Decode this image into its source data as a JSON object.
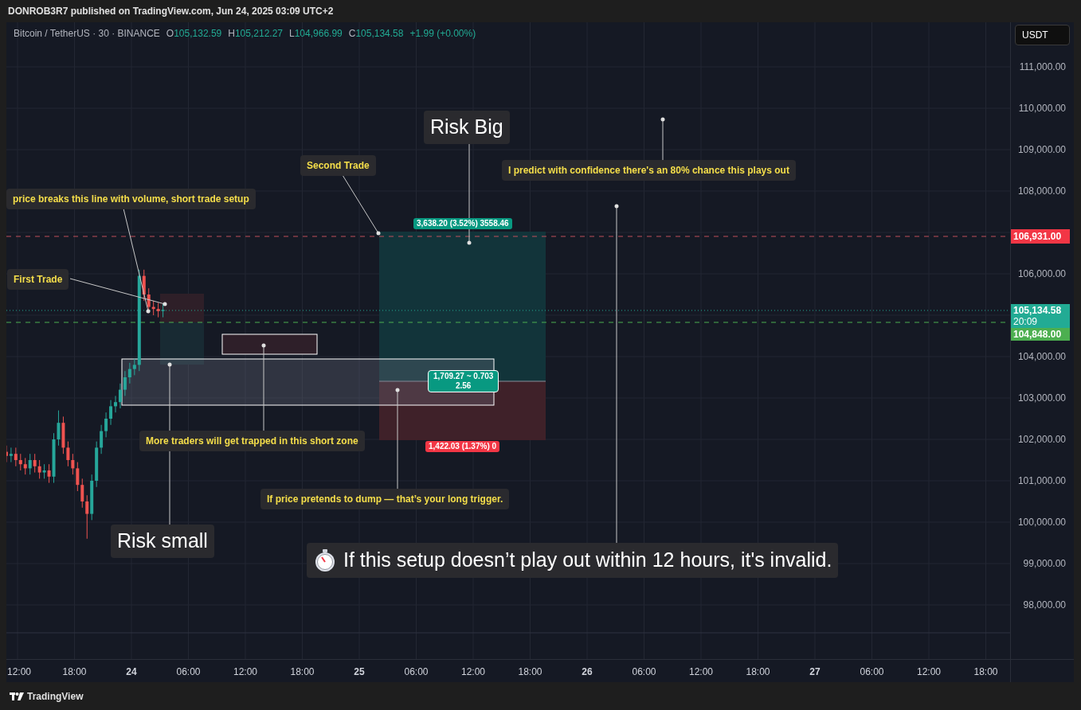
{
  "header": {
    "text": "DONROB3R7 published on TradingView.com, Jun 24, 2025 03:09 UTC+2"
  },
  "legend": {
    "symbol": "Bitcoin / TetherUS · 30 · BINANCE",
    "fields": [
      {
        "label": "O",
        "value": "105,132.59"
      },
      {
        "label": "H",
        "value": "105,212.27"
      },
      {
        "label": "L",
        "value": "104,966.99"
      },
      {
        "label": "C",
        "value": "105,134.58"
      }
    ],
    "change": "+1.99 (+0.00%)"
  },
  "currency_button": "USDT",
  "price_axis": {
    "ticks": [
      "111,000.00",
      "110,000.00",
      "109,000.00",
      "108,000.00",
      "106,000.00",
      "104,000.00",
      "103,000.00",
      "102,000.00",
      "101,000.00",
      "100,000.00",
      "99,000.00",
      "98,000.00"
    ],
    "tags": [
      {
        "text": "106,931.00",
        "color": "#f23645"
      },
      {
        "text": "105,134.58",
        "subtext": "20:09",
        "color": "#22ab94"
      },
      {
        "text": "104,848.00",
        "color": "#4caf50"
      }
    ]
  },
  "annotations": [
    {
      "kind": "note",
      "text": "price breaks this line with volume, short trade setup"
    },
    {
      "kind": "note",
      "text": "First Trade"
    },
    {
      "kind": "note",
      "text": "Second Trade"
    },
    {
      "kind": "headline",
      "text": "Risk Big"
    },
    {
      "kind": "note",
      "text": "I predict with confidence there's an 80% chance this plays out"
    },
    {
      "kind": "note",
      "text": "More traders will get trapped in this short zone"
    },
    {
      "kind": "note",
      "text": "If price pretends to dump — that’s your long trigger."
    },
    {
      "kind": "headline",
      "text": "Risk small"
    },
    {
      "kind": "timer_headline",
      "text": "If this setup doesn’t play out within 12 hours, it's invalid."
    }
  ],
  "position_labels": [
    {
      "kind": "target",
      "text": "3,638.20 (3.52%) 3558.46",
      "color": "#089981"
    },
    {
      "kind": "ratio",
      "lines": [
        "1,709.27 ~ 0.703",
        "2.56"
      ],
      "color": "#089981"
    },
    {
      "kind": "stop",
      "text": "1,422.03 (1.37%) 0",
      "color": "#f23645"
    }
  ],
  "time_axis": [
    {
      "kind": "time",
      "text": "12:00"
    },
    {
      "kind": "time",
      "text": "18:00"
    },
    {
      "kind": "day",
      "text": "24"
    },
    {
      "kind": "time",
      "text": "06:00"
    },
    {
      "kind": "time",
      "text": "12:00"
    },
    {
      "kind": "time",
      "text": "18:00"
    },
    {
      "kind": "day",
      "text": "25"
    },
    {
      "kind": "time",
      "text": "06:00"
    },
    {
      "kind": "time",
      "text": "12:00"
    },
    {
      "kind": "time",
      "text": "18:00"
    },
    {
      "kind": "day",
      "text": "26"
    },
    {
      "kind": "time",
      "text": "06:00"
    },
    {
      "kind": "time",
      "text": "12:00"
    },
    {
      "kind": "time",
      "text": "18:00"
    },
    {
      "kind": "day",
      "text": "27"
    },
    {
      "kind": "time",
      "text": "06:00"
    },
    {
      "kind": "time",
      "text": "12:00"
    },
    {
      "kind": "time",
      "text": "18:00"
    }
  ],
  "footer": {
    "brand": "TradingView"
  }
}
